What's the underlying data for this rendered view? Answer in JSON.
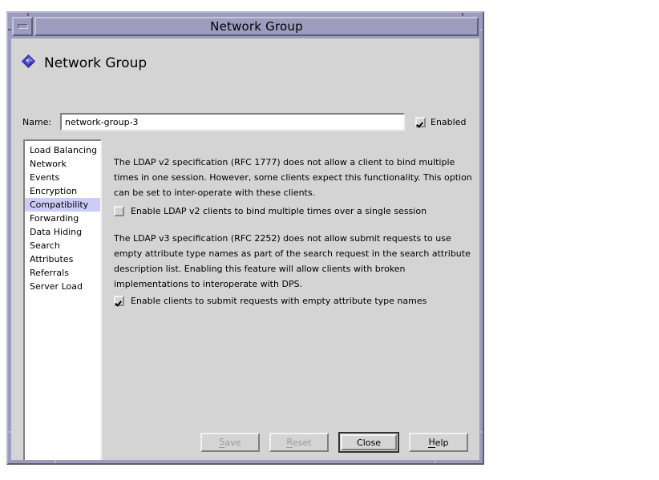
{
  "window": {
    "title": "Network Group",
    "minimize_icon": "minimize-icon"
  },
  "header": {
    "icon": "diamond-gem-icon",
    "title": "Network Group"
  },
  "name_field": {
    "label": "Name:",
    "value": "network-group-3",
    "placeholder": ""
  },
  "enabled_checkbox": {
    "label": "Enabled",
    "checked": true
  },
  "categories": {
    "selected": "Compatibility",
    "items": [
      {
        "label": "Load Balancing"
      },
      {
        "label": "Network"
      },
      {
        "label": "Events"
      },
      {
        "label": "Encryption"
      },
      {
        "label": "Compatibility"
      },
      {
        "label": "Forwarding"
      },
      {
        "label": "Data Hiding"
      },
      {
        "label": "Search"
      },
      {
        "label": "Attributes"
      },
      {
        "label": "Referrals"
      },
      {
        "label": "Server Load"
      }
    ]
  },
  "content": {
    "paragraph_1": "The LDAP v2 specification (RFC 1777) does not allow a client to bind multiple times in one session. However, some clients expect this functionality. This option can be set to inter-operate with these clients.",
    "option_1": {
      "label": "Enable LDAP v2 clients to bind multiple times over a single session",
      "checked": false
    },
    "paragraph_2": "The LDAP v3 specification (RFC 2252) does not allow submit requests to use empty attribute type names as part of the search request in the search attribute description list. Enabling this feature will allow clients with broken implementations to interoperate with DPS.",
    "option_2": {
      "label": "Enable clients to submit requests with empty attribute type names",
      "checked": true
    }
  },
  "buttons": {
    "save": {
      "label": "Save",
      "mnemonic": "S",
      "rest": "ave",
      "enabled": false
    },
    "reset": {
      "label": "Reset",
      "mnemonic": "R",
      "rest": "eset",
      "enabled": false
    },
    "close": {
      "label": "Close",
      "enabled": true,
      "default": true
    },
    "help": {
      "label": "Help",
      "mnemonic": "H",
      "rest": "elp",
      "enabled": true
    }
  },
  "colors": {
    "frame": "#9c9cbe",
    "client_bg": "#d4d4d4",
    "selection": "#ccccf7",
    "accent": "#3a3ab4"
  }
}
